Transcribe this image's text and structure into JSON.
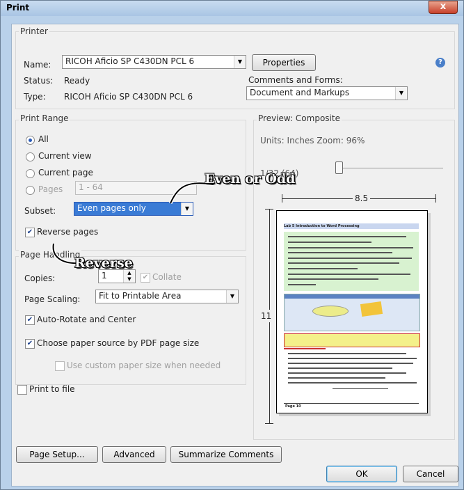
{
  "window": {
    "title": "Print",
    "close_symbol": "x"
  },
  "printer": {
    "group_label": "Printer",
    "name_label": "Name:",
    "name_value": "RICOH Aficio SP C430DN PCL 6",
    "properties_label": "Properties",
    "status_label": "Status:",
    "status_value": "Ready",
    "type_label": "Type:",
    "type_value": "RICOH Aficio SP C430DN PCL 6",
    "comments_label": "Comments and Forms:",
    "comments_value": "Document and Markups",
    "help_symbol": "?"
  },
  "print_range": {
    "group_label": "Print Range",
    "all_label": "All",
    "current_view_label": "Current view",
    "current_page_label": "Current page",
    "pages_label": "Pages",
    "pages_value": "1 - 64",
    "subset_label": "Subset:",
    "subset_value": "Even pages only",
    "reverse_label": "Reverse pages",
    "selected": "All"
  },
  "annotations": {
    "even_odd": "Even or Odd",
    "reverse": "Reverse"
  },
  "page_handling": {
    "group_label": "Page Handling",
    "copies_label": "Copies:",
    "copies_value": "1",
    "collate_label": "Collate",
    "scaling_label": "Page Scaling:",
    "scaling_value": "Fit to Printable Area",
    "auto_rotate_label": "Auto-Rotate and Center",
    "paper_source_label": "Choose paper source by PDF page size",
    "custom_paper_label": "Use custom paper size when needed"
  },
  "print_to_file_label": "Print to file",
  "preview": {
    "group_label": "Preview: Composite",
    "units_label": "Units: Inches Zoom: 96%",
    "page_counter": "1/32 (64)",
    "width_label": "8.5",
    "height_label": "11",
    "doc_title": "Lab 5 Introduction to Word Processing",
    "doc_footer": "Page 10"
  },
  "buttons": {
    "page_setup": "Page Setup...",
    "advanced": "Advanced",
    "summarize": "Summarize Comments",
    "ok": "OK",
    "cancel": "Cancel"
  }
}
